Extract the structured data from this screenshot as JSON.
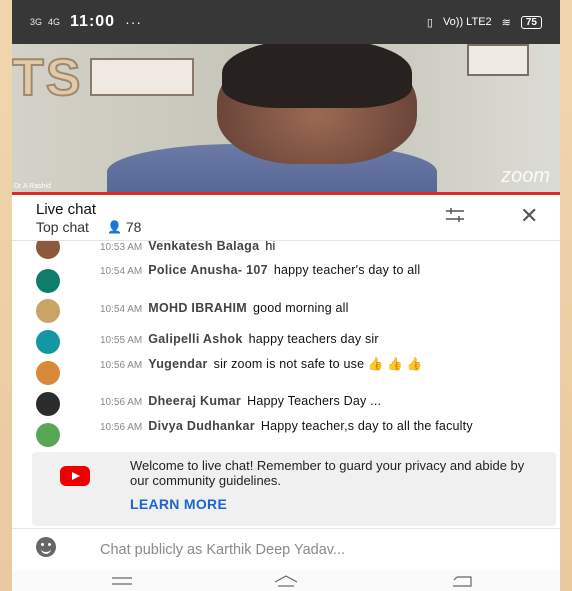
{
  "status_bar": {
    "signal_left": "3G",
    "signal_right": "4G",
    "time": "11:00",
    "dots": "···",
    "network": "Vo)) LTE2",
    "battery": "75"
  },
  "video": {
    "watermark": "TS",
    "overlay": "zoom",
    "name_tag": "Dr A Rashid"
  },
  "chat_header": {
    "title": "Live chat",
    "mode": "Top chat",
    "viewer_count": "78"
  },
  "messages": [
    {
      "time": "10:53 AM",
      "author": "Venkatesh Balaga",
      "text": "hi",
      "avatar_color": "#8b5a3a"
    },
    {
      "time": "10:54 AM",
      "author": "Police Anusha- 107",
      "text": "happy teacher's day to all",
      "avatar_color": "#0f7d68"
    },
    {
      "time": "10:54 AM",
      "author": "MOHD IBRAHIM",
      "text": "good morning all",
      "avatar_color": "#c9a465"
    },
    {
      "time": "10:55 AM",
      "author": "Galipelli Ashok",
      "text": "happy teachers day sir",
      "avatar_color": "#1597a3"
    },
    {
      "time": "10:56 AM",
      "author": "Yugendar",
      "text": "sir zoom is not safe to use 👍 👍 👍",
      "avatar_color": "#d88a3a"
    },
    {
      "time": "10:56 AM",
      "author": "Dheeraj Kumar",
      "text": "Happy Teachers Day ...",
      "avatar_color": "#2b2b2b"
    },
    {
      "time": "10:56 AM",
      "author": "Divya Dudhankar",
      "text": "Happy teacher,s day to all the faculty",
      "avatar_color": "#5aa657"
    }
  ],
  "notice": {
    "text": "Welcome to live chat! Remember to guard your privacy and abide by our community guidelines.",
    "link": "LEARN MORE"
  },
  "input": {
    "placeholder": "Chat publicly as Karthik Deep Yadav..."
  }
}
